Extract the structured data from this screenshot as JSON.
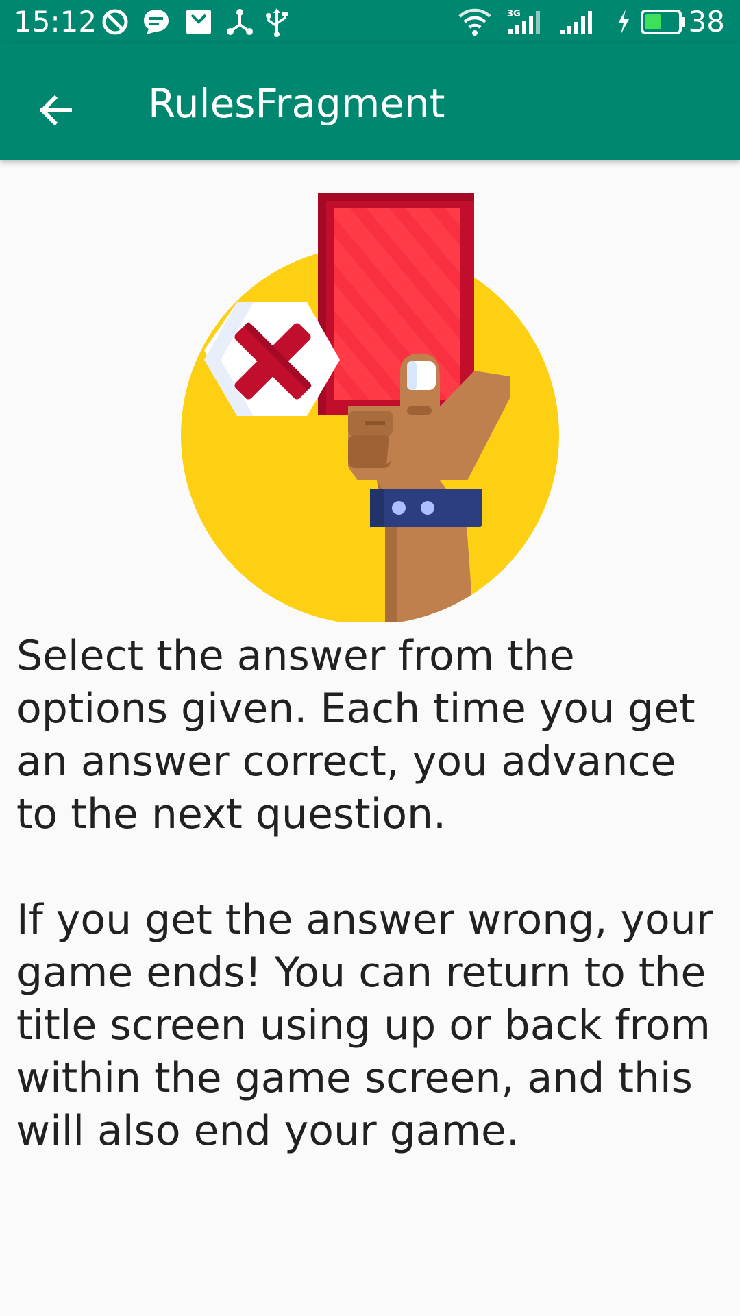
{
  "status_bar": {
    "time": "15:12",
    "battery_level": "38",
    "icons": [
      "do-not-disturb-icon",
      "message-icon",
      "mail-icon",
      "share-network-icon",
      "usb-icon",
      "wifi-icon",
      "signal-3g-icon",
      "signal-icon",
      "charging-icon",
      "battery-icon"
    ],
    "background_color": "#00876f"
  },
  "app_bar": {
    "title": "RulesFragment",
    "back_icon": "arrow-left-icon",
    "background_color": "#00876f"
  },
  "illustration": {
    "name": "referee-red-card-illustration",
    "colors": {
      "circle": "#fdd014",
      "card": "#ff3b48",
      "card_border": "#c10e2c",
      "x_mark": "#c10e2c",
      "skin": "#c0804d",
      "wristband": "#2c3e80"
    }
  },
  "rules": {
    "paragraph_1": "Select the answer from the options given. Each time you get an answer correct, you advance to the next question.",
    "paragraph_2": "If you get the answer wrong, your game ends! You can return to the title screen using up or back from within the game screen, and this will also end your game."
  }
}
